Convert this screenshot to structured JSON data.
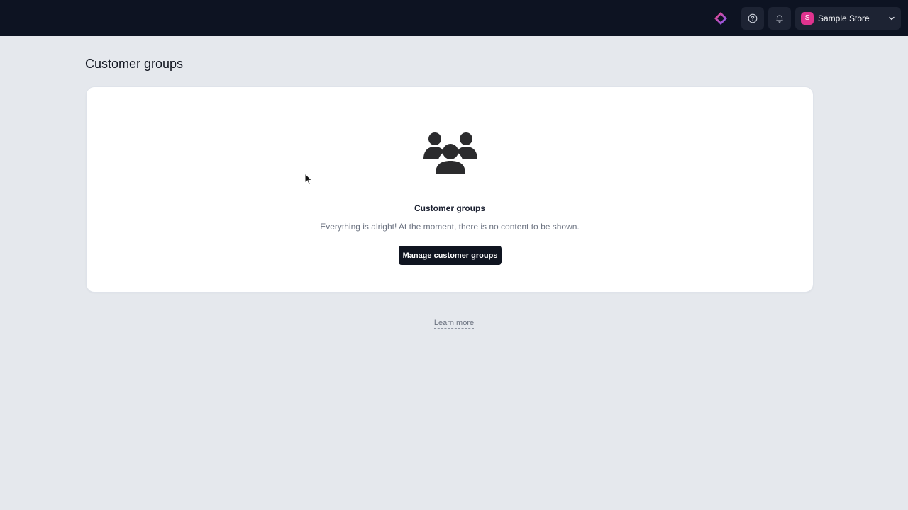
{
  "header": {
    "brand_icon": "app-logo-icon",
    "help_icon": "help-circle-icon",
    "notifications_icon": "bell-icon",
    "store": {
      "avatar_letter": "S",
      "name": "Sample Store",
      "avatar_color": "#e0338f"
    }
  },
  "page": {
    "title": "Customer groups"
  },
  "empty_state": {
    "icon": "users-group-icon",
    "title": "Customer groups",
    "description": "Everything is alright! At the moment, there is no content to be shown.",
    "button_label": "Manage customer groups"
  },
  "footer": {
    "learn_more": "Learn more"
  },
  "colors": {
    "topbar": "#0d1322",
    "background": "#e5e8ed",
    "primary_button": "#0f1420",
    "accent": "#e0338f"
  }
}
